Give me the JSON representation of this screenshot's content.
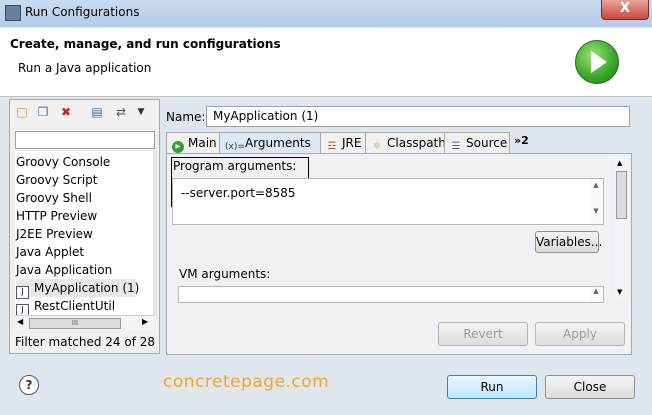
{
  "window": {
    "title": "Run Configurations",
    "close_glyph": "X"
  },
  "header": {
    "title": "Create, manage, and run configurations",
    "subtitle": "Run a Java application"
  },
  "left_panel": {
    "toolbar_icons": [
      "new-config-icon",
      "duplicate-icon",
      "delete-icon",
      "collapse-all-icon",
      "filter-icon",
      "dropdown-icon"
    ],
    "filter_placeholder": "",
    "items": [
      {
        "label": "Groovy Console"
      },
      {
        "label": "Groovy Script"
      },
      {
        "label": "Groovy Shell"
      },
      {
        "label": "HTTP Preview"
      },
      {
        "label": "J2EE Preview"
      },
      {
        "label": "Java Applet"
      },
      {
        "label": "Java Application"
      },
      {
        "label": "MyApplication (1)",
        "selected": true
      },
      {
        "label": "RestClientUtil"
      }
    ],
    "scroll_glyph": "III",
    "status": "Filter matched 24 of 28 items"
  },
  "config": {
    "name_label": "Name:",
    "name_value": "MyApplication (1)",
    "tabs": [
      {
        "label": "Main",
        "icon": "main-tab-icon"
      },
      {
        "label": "Arguments",
        "icon": "arguments-tab-icon",
        "active": true
      },
      {
        "label": "JRE",
        "icon": "jre-tab-icon"
      },
      {
        "label": "Classpath",
        "icon": "classpath-tab-icon"
      },
      {
        "label": "Source",
        "icon": "source-tab-icon"
      }
    ],
    "overflow_tabs": "»2",
    "program_args_label": "Program arguments:",
    "program_args_value": "--server.port=8585",
    "variables_label": "Variables...",
    "vm_args_label": "VM arguments:"
  },
  "buttons": {
    "revert": "Revert",
    "apply": "Apply",
    "run": "Run",
    "close": "Close"
  },
  "help_glyph": "?",
  "watermark": "concretepage.com"
}
